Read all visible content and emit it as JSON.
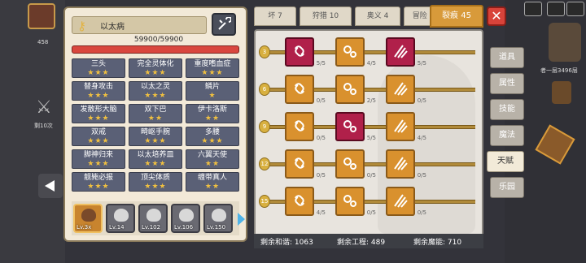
{
  "background": {
    "left_gauge_text": "剩10次",
    "left_top_number": "458",
    "floor_text": "者一层3496层",
    "colors": {
      "scene": "#33333a"
    }
  },
  "character": {
    "name": "以太病",
    "hp_text": "59900/59900",
    "hp_fraction": 1.0,
    "skills": [
      {
        "label": "三头",
        "stars": "★★★"
      },
      {
        "label": "完全灵体化",
        "stars": "★★★"
      },
      {
        "label": "重度嗜血症",
        "stars": "★★★"
      },
      {
        "label": "替身攻击",
        "stars": "★★★"
      },
      {
        "label": "以太之灵",
        "stars": "★★★"
      },
      {
        "label": "鳞片",
        "stars": "★"
      },
      {
        "label": "发散形大脑",
        "stars": "★★★"
      },
      {
        "label": "双下巴",
        "stars": "★★"
      },
      {
        "label": "伊卡洛斯",
        "stars": "★★"
      },
      {
        "label": "双戒",
        "stars": "★★★"
      },
      {
        "label": "畸岖手腕",
        "stars": "★★★"
      },
      {
        "label": "多腰",
        "stars": "★★★"
      },
      {
        "label": "脚神归来",
        "stars": "★★★"
      },
      {
        "label": "以太培养皿",
        "stars": "★★★"
      },
      {
        "label": "六翼天使",
        "stars": "★★"
      },
      {
        "label": "靓毙必报",
        "stars": "★★★"
      },
      {
        "label": "顶尖体质",
        "stars": "★★★"
      },
      {
        "label": "缠带真人",
        "stars": "★★"
      }
    ],
    "heroes": [
      {
        "level": "Lv.3x"
      },
      {
        "level": "Lv.14"
      },
      {
        "level": "Lv.102"
      },
      {
        "level": "Lv.106"
      },
      {
        "level": "Lv.150"
      }
    ]
  },
  "tabs": [
    {
      "label": "坏 7"
    },
    {
      "label": "狩猎 10"
    },
    {
      "label": "奥义 4"
    },
    {
      "label": "冒险 3"
    },
    {
      "label": "裂痕 45"
    }
  ],
  "side_tabs": [
    {
      "label": "道具"
    },
    {
      "label": "属性"
    },
    {
      "label": "技能"
    },
    {
      "label": "魔法"
    },
    {
      "label": "天赋"
    },
    {
      "label": "乐园"
    }
  ],
  "talent_rows": [
    {
      "level": "3",
      "nodes": [
        {
          "count": "5/5",
          "maxed": true,
          "icon": "link"
        },
        {
          "count": "4/5",
          "maxed": false,
          "icon": "gears"
        },
        {
          "count": "5/5",
          "maxed": true,
          "icon": "claw"
        }
      ]
    },
    {
      "level": "6",
      "nodes": [
        {
          "count": "0/5",
          "maxed": false,
          "icon": "link"
        },
        {
          "count": "2/5",
          "maxed": false,
          "icon": "gears"
        },
        {
          "count": "0/5",
          "maxed": false,
          "icon": "claw"
        }
      ]
    },
    {
      "level": "9",
      "nodes": [
        {
          "count": "0/5",
          "maxed": false,
          "icon": "link"
        },
        {
          "count": "5/5",
          "maxed": true,
          "icon": "gears"
        },
        {
          "count": "4/5",
          "maxed": false,
          "icon": "claw"
        }
      ]
    },
    {
      "level": "12",
      "nodes": [
        {
          "count": "0/5",
          "maxed": false,
          "icon": "link"
        },
        {
          "count": "0/5",
          "maxed": false,
          "icon": "gears"
        },
        {
          "count": "0/5",
          "maxed": false,
          "icon": "claw"
        }
      ]
    },
    {
      "level": "15",
      "nodes": [
        {
          "count": "4/5",
          "maxed": false,
          "icon": "link"
        },
        {
          "count": "0/5",
          "maxed": false,
          "icon": "gears"
        },
        {
          "count": "0/5",
          "maxed": false,
          "icon": "claw"
        }
      ]
    }
  ],
  "footer": {
    "harmony": "剩余和谐: 1063",
    "engineering": "剩余工程: 489",
    "magic": "剩余魔能: 710"
  },
  "close_label": "✕",
  "colors": {
    "accent": "#d89a3a",
    "maxed_node": "#b0204a",
    "hp_bar": "#d9463e",
    "star": "#f0c040"
  }
}
